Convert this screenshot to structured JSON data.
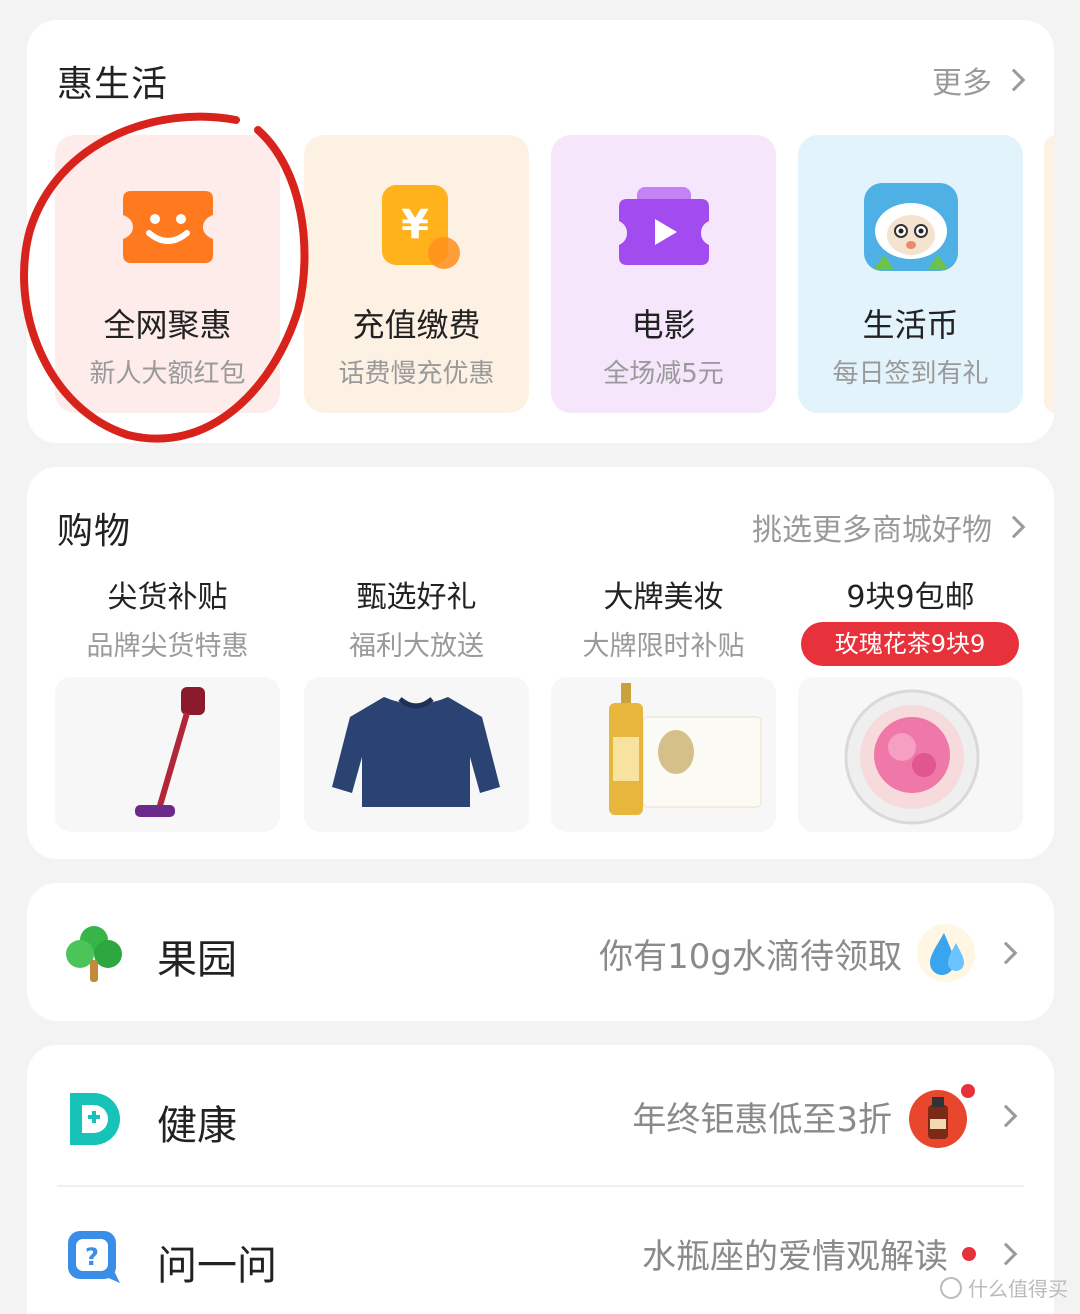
{
  "hui": {
    "title": "惠生活",
    "more_label": "更多",
    "tiles": [
      {
        "title": "全网聚惠",
        "subtitle": "新人大额红包",
        "icon": "smile-ticket-icon",
        "bg": "#fdecea",
        "color": "#ff6a22"
      },
      {
        "title": "充值缴费",
        "subtitle": "话费慢充优惠",
        "icon": "yuan-coin-icon",
        "bg": "#fdf1e4",
        "color": "#ffa21a"
      },
      {
        "title": "电影",
        "subtitle": "全场减5元",
        "icon": "movie-ticket-icon",
        "bg": "#f5e6fb",
        "color": "#a44bf0"
      },
      {
        "title": "生活币",
        "subtitle": "每日签到有礼",
        "icon": "sheep-icon",
        "bg": "#e3f3fb",
        "color": "#4fb0e6"
      }
    ]
  },
  "shopping": {
    "title": "购物",
    "more_label": "挑选更多商城好物",
    "items": [
      {
        "title": "尖货补贴",
        "subtitle": "品牌尖货特惠",
        "icon": "vacuum-cleaner-image"
      },
      {
        "title": "甄选好礼",
        "subtitle": "福利大放送",
        "icon": "sweater-image"
      },
      {
        "title": "大牌美妆",
        "subtitle": "大牌限时补贴",
        "icon": "serum-bottle-image"
      },
      {
        "title": "9块9包邮",
        "badge": "玫瑰花茶9块9",
        "icon": "rose-tea-image"
      }
    ]
  },
  "rows": [
    {
      "title": "果园",
      "right": "你有10g水滴待领取",
      "icon": "tree-icon",
      "thumb": "water-drop-icon"
    },
    {
      "title": "健康",
      "right": "年终钜惠低至3折",
      "icon": "health-d-icon",
      "thumb": "medicine-bottle-icon"
    },
    {
      "title": "问一问",
      "right": "水瓶座的爱情观解读",
      "icon": "question-chat-icon"
    }
  ],
  "watermark": "什么值得买",
  "colors": {
    "badge_red": "#e8323b",
    "annotation_red": "#d8231c"
  }
}
